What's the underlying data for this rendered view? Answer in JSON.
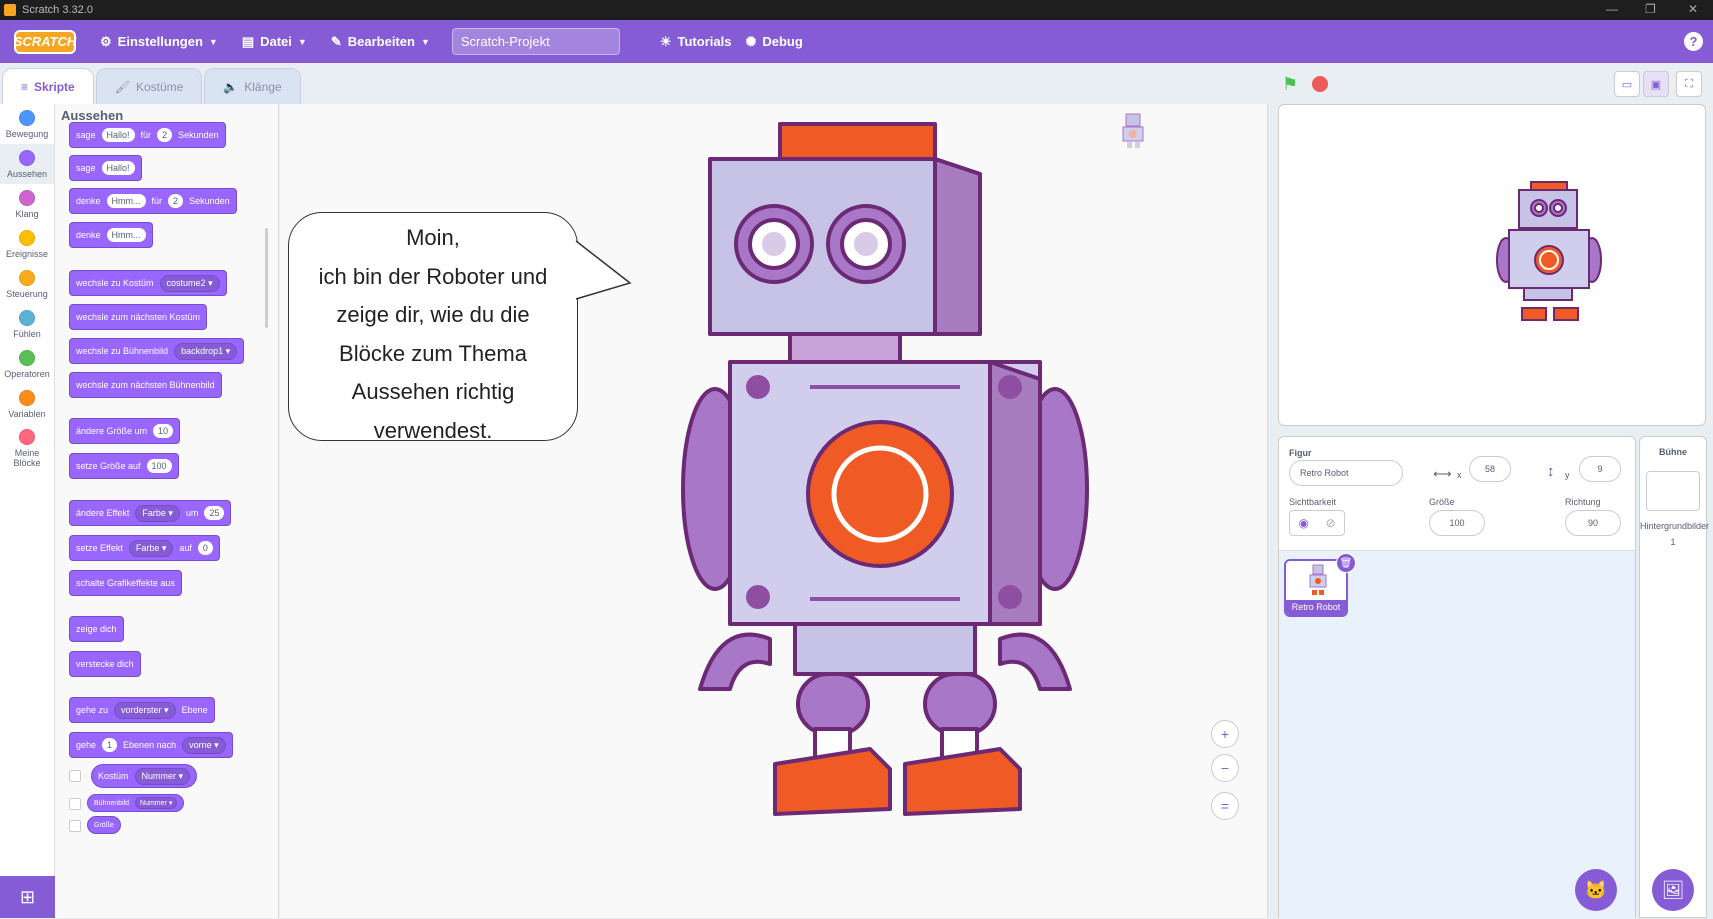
{
  "window": {
    "title": "Scratch 3.32.0"
  },
  "menubar": {
    "logo": "SCRATCH",
    "settings": "Einstellungen",
    "file": "Datei",
    "edit": "Bearbeiten",
    "project_title": "Scratch-Projekt",
    "tutorials": "Tutorials",
    "debug": "Debug",
    "help": "?"
  },
  "tabs": {
    "code": "Skripte",
    "costumes": "Kostüme",
    "sounds": "Klänge"
  },
  "categories": [
    {
      "label": "Bewegung",
      "color": "#4c97ff"
    },
    {
      "label": "Aussehen",
      "color": "#9966ff"
    },
    {
      "label": "Klang",
      "color": "#cf63cf"
    },
    {
      "label": "Ereignisse",
      "color": "#ffbf00"
    },
    {
      "label": "Steuerung",
      "color": "#ffab19"
    },
    {
      "label": "Fühlen",
      "color": "#5cb1d6"
    },
    {
      "label": "Operatoren",
      "color": "#59c059"
    },
    {
      "label": "Variablen",
      "color": "#ff8c1a"
    },
    {
      "label": "Meine Blöcke",
      "color": "#ff6680"
    }
  ],
  "palette": {
    "heading": "Aussehen",
    "b1": {
      "a": "sage",
      "v1": "Hallo!",
      "b": "für",
      "v2": "2",
      "c": "Sekunden"
    },
    "b2": {
      "a": "sage",
      "v1": "Hallo!"
    },
    "b3": {
      "a": "denke",
      "v1": "Hmm...",
      "b": "für",
      "v2": "2",
      "c": "Sekunden"
    },
    "b4": {
      "a": "denke",
      "v1": "Hmm..."
    },
    "b5": {
      "a": "wechsle zu Kostüm",
      "v1": "costume2"
    },
    "b6": {
      "a": "wechsle zum nächsten Kostüm"
    },
    "b7": {
      "a": "wechsle zu Bühnenbild",
      "v1": "backdrop1"
    },
    "b8": {
      "a": "wechsle zum nächsten Bühnenbild"
    },
    "b9": {
      "a": "ändere Größe um",
      "v1": "10"
    },
    "b10": {
      "a": "setze Größe auf",
      "v1": "100"
    },
    "b11": {
      "a": "ändere Effekt",
      "v1": "Farbe",
      "b": "um",
      "v2": "25"
    },
    "b12": {
      "a": "setze Effekt",
      "v1": "Farbe",
      "b": "auf",
      "v2": "0"
    },
    "b13": {
      "a": "schalte Grafikeffekte aus"
    },
    "b14": {
      "a": "zeige dich"
    },
    "b15": {
      "a": "verstecke dich"
    },
    "b16": {
      "a": "gehe zu",
      "v1": "vorderster",
      "b": "Ebene"
    },
    "b17": {
      "a": "gehe",
      "v1": "1",
      "b": "Ebenen nach",
      "v2": "vorne"
    },
    "r1": {
      "a": "Kostüm",
      "v1": "Nummer"
    },
    "r2": {
      "a": "Bühnenbild",
      "v1": "Nummer"
    },
    "r3": {
      "a": "Größe"
    }
  },
  "workspace": {
    "speech": [
      "Moin,",
      "ich bin der Roboter und",
      "zeige dir, wie du die",
      "Blöcke zum Thema",
      "Aussehen richtig",
      "verwendest."
    ],
    "zoom_in": "+",
    "zoom_out": "−",
    "zoom_reset": "="
  },
  "sprite_info": {
    "label_sprite": "Figur",
    "sprite_name": "Retro Robot",
    "x_label": "x",
    "x_value": "58",
    "y_label": "y",
    "y_value": "9",
    "label_show": "Sichtbarkeit",
    "label_size": "Größe",
    "size_value": "100",
    "label_direction": "Richtung",
    "direction_value": "90"
  },
  "sprites": [
    {
      "name": "Retro Robot"
    }
  ],
  "stage_pane": {
    "title": "Bühne",
    "backdrops_label": "Hintergrundbilder",
    "backdrops_count": "1"
  },
  "colors": {
    "accent": "#855cd6",
    "looks": "#9966ff",
    "robot_purple": "#7d2f8a",
    "robot_orange": "#f05a24"
  }
}
